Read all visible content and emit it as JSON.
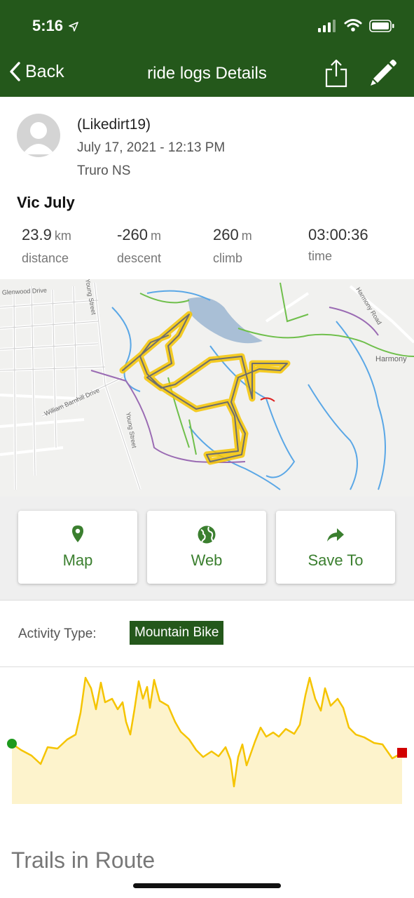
{
  "status_bar": {
    "time": "5:16"
  },
  "nav": {
    "back_label": "Back",
    "title": "ride logs Details"
  },
  "ride": {
    "username": "(Likedirt19)",
    "date": "July 17, 2021 - 12:13 PM",
    "location": "Truro NS",
    "title": "Vic July"
  },
  "stats": {
    "distance": {
      "value": "23.9",
      "unit": "km",
      "label": "distance"
    },
    "descent": {
      "value": "-260",
      "unit": "m",
      "label": "descent"
    },
    "climb": {
      "value": "260",
      "unit": "m",
      "label": "climb"
    },
    "time": {
      "value": "03:00:36",
      "label": "time"
    }
  },
  "map": {
    "labels": {
      "glenwood": "Glenwood Drive",
      "young_top": "Young Street",
      "young_bottom": "Young Street",
      "barnhill": "William Barnhill Drive",
      "harmony_road": "Harmony Road",
      "harmony": "Harmony"
    }
  },
  "actions": {
    "map": "Map",
    "web": "Web",
    "save_to": "Save To"
  },
  "activity": {
    "label": "Activity Type:",
    "type": "Mountain Bike"
  },
  "trails_heading": "Trails in Route",
  "colors": {
    "brand_green": "#24581b",
    "accent_green": "#3b7f2f",
    "route_yellow": "#f5c400",
    "elevation_fill": "#fdf3cc",
    "start_marker": "#1e9a1e",
    "end_marker": "#d10000"
  },
  "icons": {
    "back": "chevron-left-icon",
    "share": "share-icon",
    "edit": "pencil-icon",
    "map": "map-pin-icon",
    "web": "globe-icon",
    "save_to": "share-arrow-icon"
  }
}
